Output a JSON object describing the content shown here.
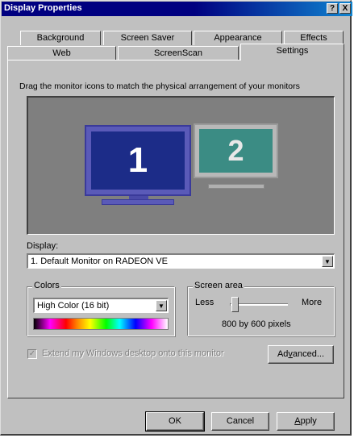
{
  "window": {
    "title": "Display Properties"
  },
  "titlebar": {
    "help_label": "?",
    "close_label": "X"
  },
  "tabs": {
    "row1": [
      "Background",
      "Screen Saver",
      "Appearance",
      "Effects"
    ],
    "row2": [
      "Web",
      "ScreenScan",
      "Settings"
    ],
    "active": "Settings"
  },
  "settings": {
    "instruction": "Drag the monitor icons to match the physical arrangement of your monitors",
    "monitors": [
      {
        "label": "1",
        "color": "#1c2c88",
        "selected": true
      },
      {
        "label": "2",
        "color": "#3b8c84",
        "selected": false
      }
    ],
    "display_label": "Display:",
    "display_value": "1. Default Monitor on RADEON VE",
    "colors": {
      "group_label": "Colors",
      "value": "High Color (16 bit)"
    },
    "screen_area": {
      "group_label": "Screen area",
      "less_label": "Less",
      "more_label": "More",
      "value_text": "800 by 600 pixels",
      "slider_level": 0.05
    },
    "extend_desktop": {
      "label": "Extend my Windows desktop onto this monitor",
      "checked": true,
      "enabled": false
    },
    "advanced": {
      "label_pre": "Ad",
      "label_u": "v",
      "label_post": "anced..."
    }
  },
  "footer": {
    "ok_label": "OK",
    "cancel_label": "Cancel",
    "apply": {
      "label_u": "A",
      "label_post": "pply"
    }
  },
  "icons": {
    "dropdown": "chevron-down-icon",
    "check": "check-icon",
    "help": "help-icon",
    "close": "close-icon"
  }
}
